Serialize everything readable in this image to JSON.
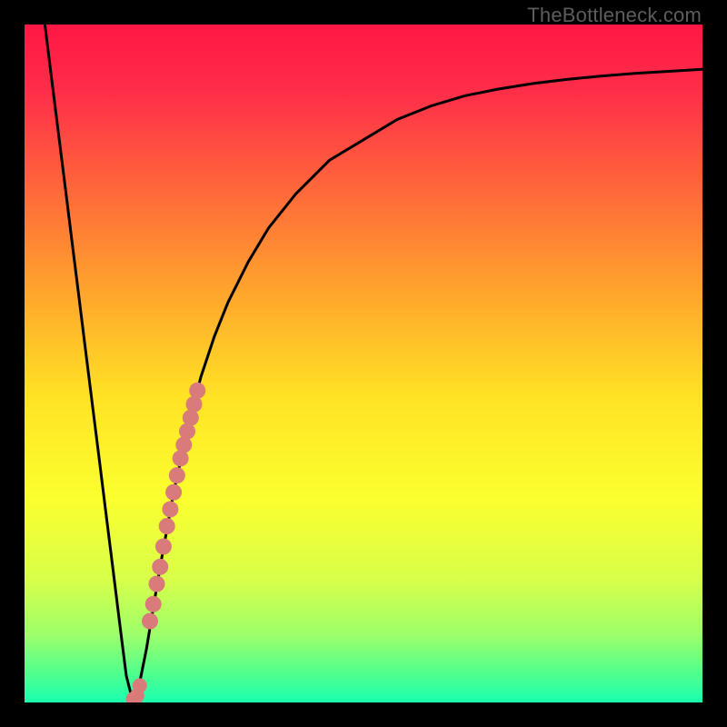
{
  "watermark": "TheBottleneck.com",
  "colors": {
    "gradient_stops": [
      {
        "offset": 0.0,
        "color": "#ff1744"
      },
      {
        "offset": 0.1,
        "color": "#ff2e49"
      },
      {
        "offset": 0.25,
        "color": "#ff6a3a"
      },
      {
        "offset": 0.4,
        "color": "#ffa72c"
      },
      {
        "offset": 0.55,
        "color": "#ffe324"
      },
      {
        "offset": 0.7,
        "color": "#fbff2e"
      },
      {
        "offset": 0.82,
        "color": "#d7ff4a"
      },
      {
        "offset": 0.9,
        "color": "#9dff6a"
      },
      {
        "offset": 0.96,
        "color": "#4dff8f"
      },
      {
        "offset": 1.0,
        "color": "#19ffb0"
      }
    ],
    "curve": "#000000",
    "marker": "#d87b7a",
    "marker2": "#d87b7a"
  },
  "chart_data": {
    "type": "line",
    "title": "",
    "xlabel": "",
    "ylabel": "",
    "xlim": [
      0,
      100
    ],
    "ylim": [
      0,
      100
    ],
    "series": [
      {
        "name": "bottleneck-curve",
        "x": [
          3,
          4,
          5,
          6,
          7,
          8,
          9,
          10,
          11,
          12,
          13,
          14,
          15,
          16,
          17,
          18,
          19,
          20,
          22,
          24,
          26,
          28,
          30,
          33,
          36,
          40,
          45,
          50,
          55,
          60,
          65,
          70,
          75,
          80,
          85,
          90,
          95,
          100
        ],
        "y": [
          100,
          92,
          84,
          76,
          68,
          60,
          52,
          44,
          36,
          28,
          20,
          12,
          4,
          0,
          3,
          8,
          14,
          20,
          31,
          40,
          48,
          54,
          59,
          65,
          70,
          75,
          80,
          83,
          86,
          88,
          89.5,
          90.5,
          91.3,
          91.9,
          92.4,
          92.8,
          93.1,
          93.4
        ]
      }
    ],
    "markers": [
      {
        "name": "highlight-segment",
        "x": [
          18.5,
          19.0,
          19.5,
          20.0,
          20.5,
          21.0,
          21.5,
          22.0,
          22.5,
          23.0,
          23.5,
          24.0,
          24.5,
          25.0,
          25.5
        ],
        "y": [
          12.0,
          14.5,
          17.5,
          20.0,
          23.0,
          26.0,
          28.5,
          31.0,
          33.5,
          36.0,
          38.0,
          40.0,
          42.0,
          44.0,
          46.0
        ]
      },
      {
        "name": "highlight-point",
        "x": [
          16.0,
          16.3,
          16.6,
          17.0
        ],
        "y": [
          0.5,
          0.3,
          1.0,
          2.5
        ]
      }
    ]
  }
}
